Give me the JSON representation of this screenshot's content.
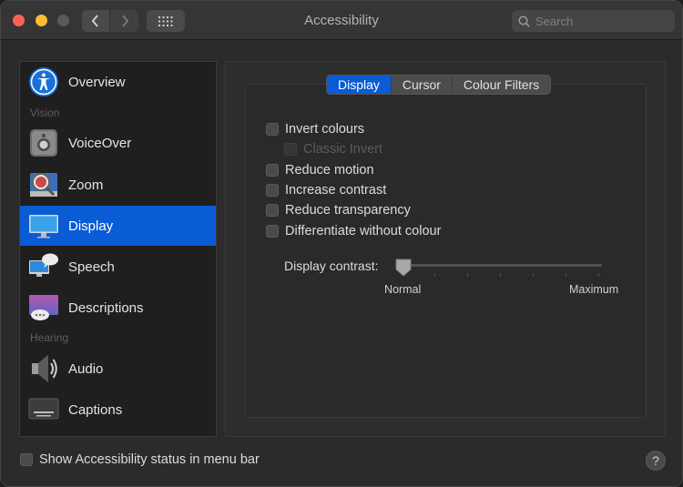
{
  "window": {
    "title": "Accessibility"
  },
  "search": {
    "placeholder": "Search"
  },
  "sidebar": {
    "sections": {
      "vision": "Vision",
      "hearing": "Hearing"
    },
    "items": [
      {
        "label": "Overview",
        "icon": "accessibility-icon"
      },
      {
        "label": "VoiceOver",
        "icon": "voiceover-icon"
      },
      {
        "label": "Zoom",
        "icon": "zoom-icon"
      },
      {
        "label": "Display",
        "icon": "display-icon",
        "selected": true
      },
      {
        "label": "Speech",
        "icon": "speech-icon"
      },
      {
        "label": "Descriptions",
        "icon": "descriptions-icon"
      },
      {
        "label": "Audio",
        "icon": "audio-icon"
      },
      {
        "label": "Captions",
        "icon": "captions-icon"
      }
    ]
  },
  "tabs": [
    {
      "label": "Display",
      "active": true
    },
    {
      "label": "Cursor"
    },
    {
      "label": "Colour Filters"
    }
  ],
  "options": [
    {
      "label": "Invert colours",
      "checked": false
    },
    {
      "label": "Classic Invert",
      "checked": false,
      "disabled": true
    },
    {
      "label": "Reduce motion",
      "checked": false
    },
    {
      "label": "Increase contrast",
      "checked": false
    },
    {
      "label": "Reduce transparency",
      "checked": false
    },
    {
      "label": "Differentiate without colour",
      "checked": false
    }
  ],
  "contrast": {
    "label": "Display contrast:",
    "min_label": "Normal",
    "max_label": "Maximum",
    "value": 0
  },
  "footer": {
    "status_label": "Show Accessibility status in menu bar",
    "help": "?"
  },
  "colors": {
    "accent": "#0a5bd6",
    "window_bg": "#2b2b2c"
  }
}
